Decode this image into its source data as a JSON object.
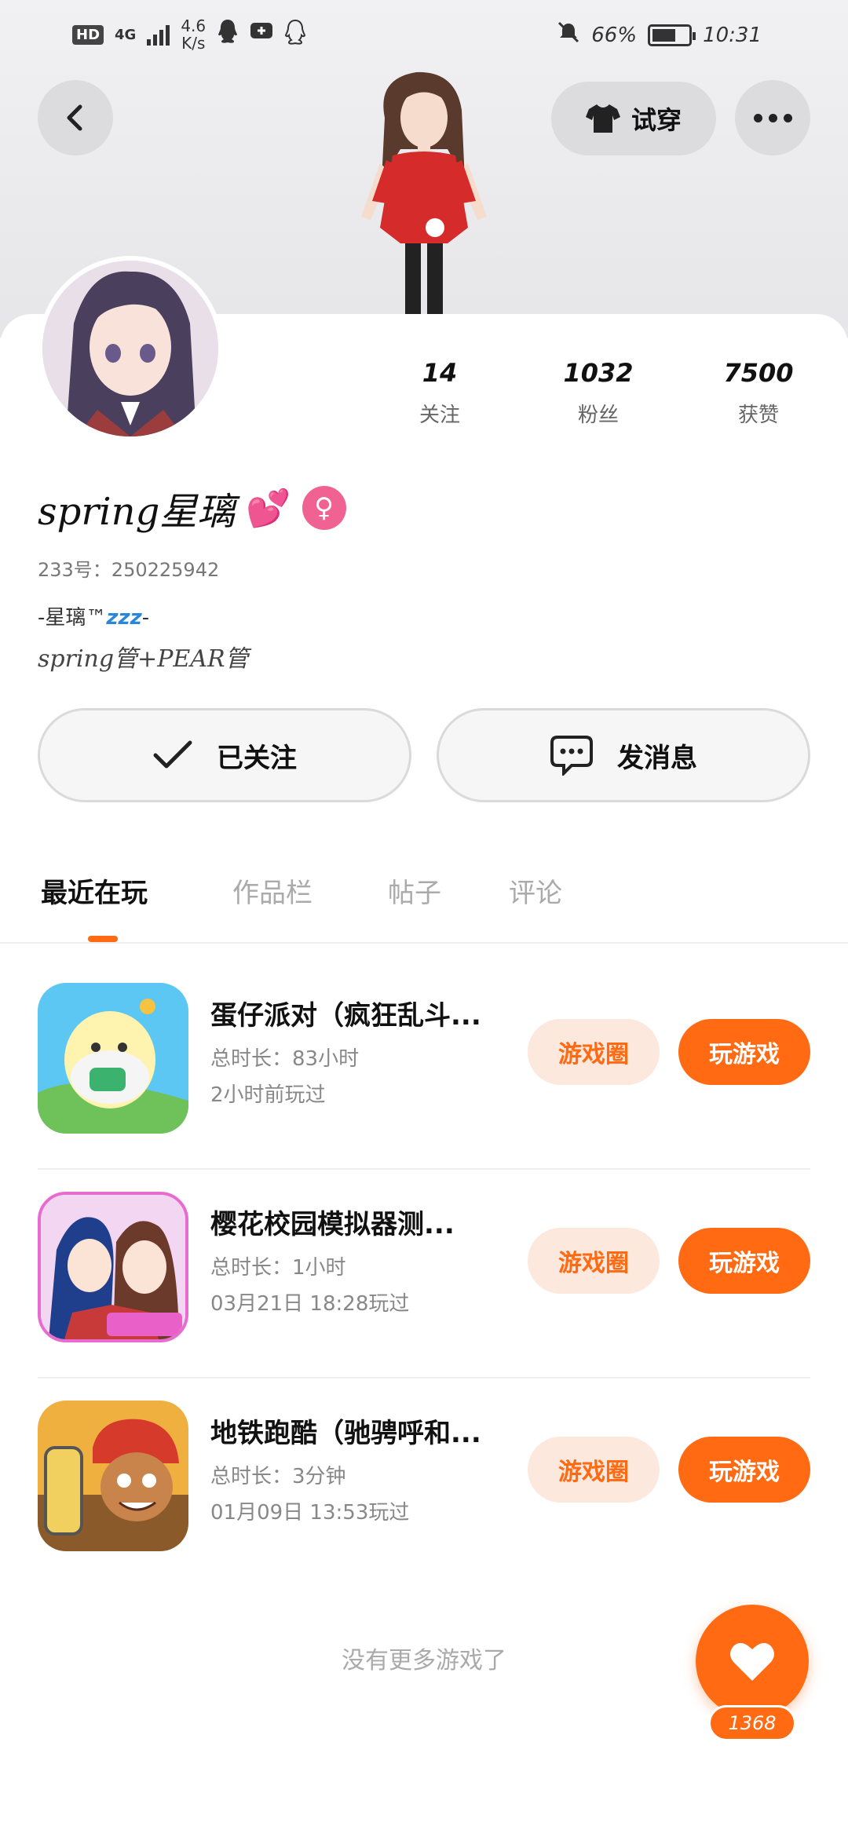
{
  "status_bar": {
    "hd": "HD",
    "network": "4G",
    "speed_value": "4.6",
    "speed_unit": "K/s",
    "battery_percent": "66%",
    "battery_level": 0.66,
    "time": "10:31"
  },
  "header": {
    "try_on_label": "试穿"
  },
  "stats": [
    {
      "value": "14",
      "label": "关注"
    },
    {
      "value": "1032",
      "label": "粉丝"
    },
    {
      "value": "7500",
      "label": "获赞"
    }
  ],
  "profile": {
    "name": "spring星璃",
    "name_emoji": "💕",
    "gender_symbol": "♀",
    "uid": "233号：250225942",
    "bio_line1_prefix": "-星璃™",
    "bio_line1_zz": "zzz",
    "bio_line1_suffix": "-",
    "bio_line2": "spring管+PEAR管"
  },
  "actions": {
    "follow_label": "已关注",
    "message_label": "发消息"
  },
  "tabs": [
    {
      "label": "最近在玩",
      "active": true
    },
    {
      "label": "作品栏",
      "active": false
    },
    {
      "label": "帖子",
      "active": false
    },
    {
      "label": "评论",
      "active": false
    }
  ],
  "games": [
    {
      "title": "蛋仔派对（疯狂乱斗...",
      "duration": "总时长：83小时",
      "last_played": "2小时前玩过",
      "circle_label": "游戏圈",
      "play_label": "玩游戏"
    },
    {
      "title": "樱花校园模拟器测...",
      "duration": "总时长：1小时",
      "last_played": "03月21日 18:28玩过",
      "circle_label": "游戏圈",
      "play_label": "玩游戏"
    },
    {
      "title": "地铁跑酷（驰骋呼和...",
      "duration": "总时长：3分钟",
      "last_played": "01月09日 13:53玩过",
      "circle_label": "游戏圈",
      "play_label": "玩游戏"
    }
  ],
  "no_more_text": "没有更多游戏了",
  "like_count": "1368",
  "colors": {
    "accent": "#ff6a13",
    "accent_light": "#fde8dd",
    "gender_pink": "#f06292"
  }
}
